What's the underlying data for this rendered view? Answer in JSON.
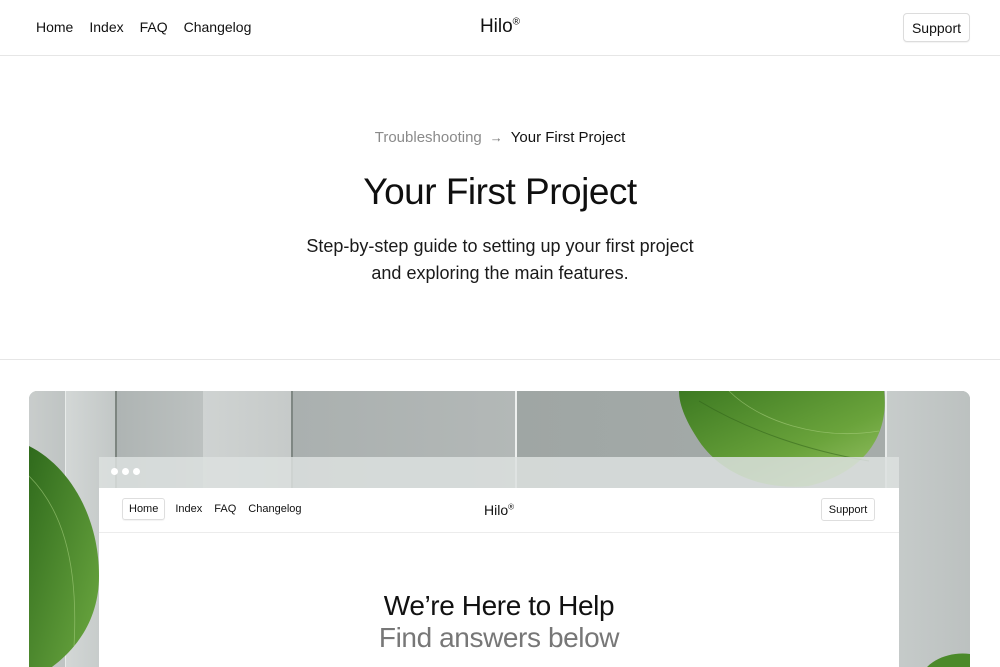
{
  "nav": {
    "links": [
      "Home",
      "Index",
      "FAQ",
      "Changelog"
    ],
    "logo": "Hilo",
    "logo_mark": "®",
    "support_label": "Support"
  },
  "hero": {
    "breadcrumb": {
      "parent": "Troubleshooting",
      "separator": "→",
      "current": "Your First Project"
    },
    "title": "Your First Project",
    "subtitle_line1": "Step-by-step guide to setting up your first project",
    "subtitle_line2": "and exploring the main features."
  },
  "preview": {
    "nav": {
      "links": [
        "Home",
        "Index",
        "FAQ",
        "Changelog"
      ],
      "logo": "Hilo",
      "logo_mark": "®",
      "support_label": "Support"
    },
    "heading": "We’re Here to Help",
    "subheading": "Find answers below"
  },
  "colors": {
    "text": "#111111",
    "muted": "#8a8a8a",
    "border": "#e6e6e6",
    "leaf_green": "#4f8a2c"
  }
}
